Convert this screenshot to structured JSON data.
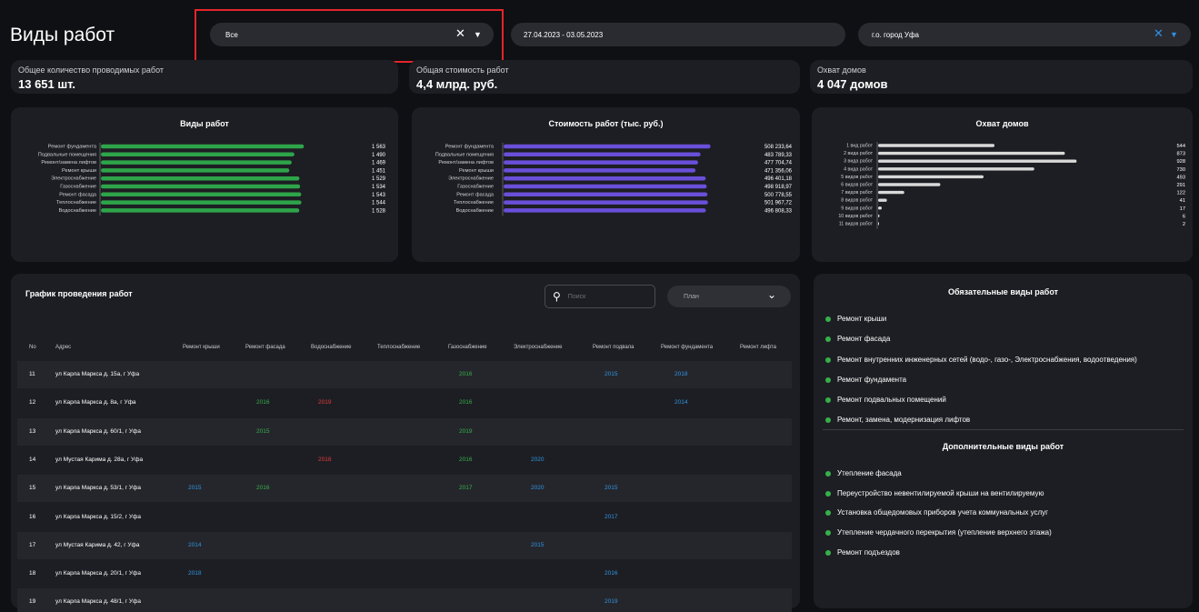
{
  "header": {
    "title": "Виды работ",
    "type_filter": "Все",
    "date_range": "27.04.2023 - 03.05.2023",
    "city_filter": "г.о. город Уфа"
  },
  "stats": [
    {
      "label": "Общее количество проводимых работ",
      "value": "13 651 шт."
    },
    {
      "label": "Общая стоимость работ",
      "value": "4,4 млрд. руб."
    },
    {
      "label": "Охват домов",
      "value": "4 047 домов"
    }
  ],
  "chart_data": [
    {
      "type": "bar",
      "title": "Виды работ",
      "categories": [
        "Ремонт фундамента",
        "Подвальные помещения",
        "Ремонт/замена лифтов",
        "Ремонт крыши",
        "Электроснабжение",
        "Газоснабжение",
        "Ремонт фасада",
        "Теплоснабжение",
        "Водоснабжение"
      ],
      "values": [
        1563,
        1490,
        1469,
        1451,
        1529,
        1534,
        1543,
        1544,
        1528
      ],
      "labels": [
        "1 563",
        "1 490",
        "1 469",
        "1 451",
        "1 529",
        "1 534",
        "1 543",
        "1 544",
        "1 528"
      ],
      "color": "#2ea44a"
    },
    {
      "type": "bar",
      "title": "Стоимость работ (тыс. руб.)",
      "categories": [
        "Ремонт фундамента",
        "Подвальные помещения",
        "Ремонт/замена лифтов",
        "Ремонт крыши",
        "Электроснабжение",
        "Газоснабжение",
        "Ремонт фасада",
        "Теплоснабжение",
        "Водоснабжение"
      ],
      "values": [
        508233.64,
        483789.33,
        477704.74,
        471356.06,
        496401.18,
        498918.97,
        500778.55,
        501967.72,
        496808.33
      ],
      "labels": [
        "508 233,64",
        "483 789,33",
        "477 704,74",
        "471 356,06",
        "496 401,18",
        "498 918,97",
        "500 778,55",
        "501 967,72",
        "496 808,33"
      ],
      "color": "#6a4fd9"
    },
    {
      "type": "bar",
      "title": "Охват домов",
      "categories": [
        "1 вид работ",
        "2 вида работ",
        "3 вида работ",
        "4 вида работ",
        "5 видов работ",
        "6 видов работ",
        "7 видов работ",
        "8 видов работ",
        "9 видов работ",
        "10 видов работ",
        "11 видов работ"
      ],
      "values": [
        544,
        873,
        928,
        730,
        493,
        291,
        122,
        41,
        17,
        6,
        2
      ],
      "labels": [
        "544",
        "873",
        "928",
        "730",
        "493",
        "291",
        "122",
        "41",
        "17",
        "6",
        "2"
      ],
      "color": "#d9d9d9"
    }
  ],
  "schedule": {
    "title": "График проведения работ",
    "search_placeholder": "Поиск",
    "plan_label": "План",
    "columns": [
      "No",
      "Адрес",
      "Ремонт крыши",
      "Ремонт фасада",
      "Водоснабжение",
      "Теплоснабжение",
      "Газоснабжение",
      "Электроснабжение",
      "Ремонт подвала",
      "Ремонт фундамента",
      "Ремонт лифта"
    ],
    "rows": [
      {
        "no": "11",
        "addr": "ул Карла Маркса д. 15а, г Уфа",
        "cells": [
          [
            "",
            ""
          ],
          [
            "",
            ""
          ],
          [
            "",
            ""
          ],
          [
            "",
            ""
          ],
          [
            "2016",
            "g"
          ],
          [
            "",
            ""
          ],
          [
            "2015",
            "b"
          ],
          [
            "2018",
            "b"
          ],
          [
            "",
            ""
          ]
        ]
      },
      {
        "no": "12",
        "addr": "ул Карла Маркса д. 8а, г Уфа",
        "cells": [
          [
            "",
            ""
          ],
          [
            "2016",
            "g"
          ],
          [
            "2019",
            "r"
          ],
          [
            "",
            ""
          ],
          [
            "2016",
            "g"
          ],
          [
            "",
            ""
          ],
          [
            "",
            ""
          ],
          [
            "2014",
            "b"
          ],
          [
            "",
            ""
          ]
        ]
      },
      {
        "no": "13",
        "addr": "ул Карла Маркса д. 60/1, г Уфа",
        "cells": [
          [
            "",
            ""
          ],
          [
            "2015",
            "g"
          ],
          [
            "",
            ""
          ],
          [
            "",
            ""
          ],
          [
            "2019",
            "g"
          ],
          [
            "",
            ""
          ],
          [
            "",
            ""
          ],
          [
            "",
            ""
          ],
          [
            "",
            ""
          ]
        ]
      },
      {
        "no": "14",
        "addr": "ул Мустая Карима д. 28а, г Уфа",
        "cells": [
          [
            "",
            ""
          ],
          [
            "",
            ""
          ],
          [
            "2018",
            "r"
          ],
          [
            "",
            ""
          ],
          [
            "2016",
            "g"
          ],
          [
            "2020",
            "b"
          ],
          [
            "",
            ""
          ],
          [
            "",
            ""
          ],
          [
            "",
            ""
          ]
        ]
      },
      {
        "no": "15",
        "addr": "ул Карла Маркса д. 53/1, г Уфа",
        "cells": [
          [
            "2015",
            "b"
          ],
          [
            "2016",
            "g"
          ],
          [
            "",
            ""
          ],
          [
            "",
            ""
          ],
          [
            "2017",
            "g"
          ],
          [
            "2020",
            "b"
          ],
          [
            "2015",
            "b"
          ],
          [
            "",
            ""
          ],
          [
            "",
            ""
          ]
        ]
      },
      {
        "no": "16",
        "addr": "ул Карла Маркса д. 15/2, г Уфа",
        "cells": [
          [
            "",
            ""
          ],
          [
            "",
            ""
          ],
          [
            "",
            ""
          ],
          [
            "",
            ""
          ],
          [
            "",
            ""
          ],
          [
            "",
            ""
          ],
          [
            "2017",
            "b"
          ],
          [
            "",
            ""
          ],
          [
            "",
            ""
          ]
        ]
      },
      {
        "no": "17",
        "addr": "ул Мустая Карима д. 42, г Уфа",
        "cells": [
          [
            "2014",
            "b"
          ],
          [
            "",
            ""
          ],
          [
            "",
            ""
          ],
          [
            "",
            ""
          ],
          [
            "",
            ""
          ],
          [
            "2015",
            "b"
          ],
          [
            "",
            ""
          ],
          [
            "",
            ""
          ],
          [
            "",
            ""
          ]
        ]
      },
      {
        "no": "18",
        "addr": "ул Карла Маркса д. 20/1, г Уфа",
        "cells": [
          [
            "2018",
            "b"
          ],
          [
            "",
            ""
          ],
          [
            "",
            ""
          ],
          [
            "",
            ""
          ],
          [
            "",
            ""
          ],
          [
            "",
            ""
          ],
          [
            "2016",
            "b"
          ],
          [
            "",
            ""
          ],
          [
            "",
            ""
          ]
        ]
      },
      {
        "no": "19",
        "addr": "ул Карла Маркса д. 48/1, г Уфа",
        "cells": [
          [
            "",
            ""
          ],
          [
            "",
            ""
          ],
          [
            "",
            ""
          ],
          [
            "",
            ""
          ],
          [
            "",
            ""
          ],
          [
            "",
            ""
          ],
          [
            "2019",
            "b"
          ],
          [
            "",
            ""
          ],
          [
            "",
            ""
          ]
        ]
      }
    ]
  },
  "required": {
    "title": "Обязательные виды работ",
    "items": [
      "Ремонт крыши",
      "Ремонт фасада",
      "Ремонт внутренних инженерных сетей (водо-, газо-, Электроснабжения, водоотведения)",
      "Ремонт фундамента",
      "Ремонт подвальных помещений",
      "Ремонт, замена, модернизация лифтов"
    ]
  },
  "additional": {
    "title": "Дополнительные виды работ",
    "items": [
      "Утепление фасада",
      "Переустройство невентилируемой крыши на вентилируемую",
      "Установка общедомовых приборов учета коммунальных услуг",
      "Утепление чердачного перекрытия (утепление верхнего этажа)",
      "Ремонт подъездов"
    ]
  },
  "icons": {
    "clear": "close-icon",
    "dropdown": "chevron-down-icon",
    "search": "search-icon"
  }
}
